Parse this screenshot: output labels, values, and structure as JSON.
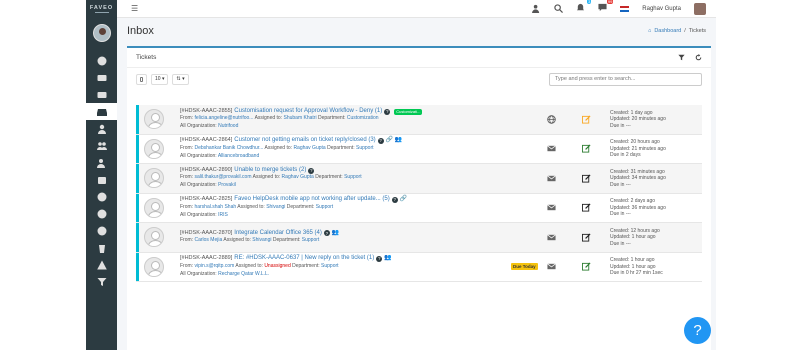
{
  "app": {
    "logo": "FAVEO"
  },
  "topbar": {
    "username": "Raghav Gupta",
    "notif_count": "3",
    "msg_count": "99"
  },
  "page": {
    "title": "Inbox",
    "breadcrumb_home": "Dashboard",
    "breadcrumb_current": "Tickets"
  },
  "card": {
    "title": "Tickets"
  },
  "controls": {
    "page_size": "10",
    "search_placeholder": "Type and press enter to search..."
  },
  "colors": {
    "sidebar": "#2c3b41",
    "accent": "#3c8dbc",
    "link": "#337ab7",
    "help": "#2196f3"
  },
  "tickets": [
    {
      "id": "[#HDSK-AAAC-2855]",
      "subject": "Customisation request for Approval Workflow - Deny (1)",
      "tag": "Customizati...",
      "from_label": "From:",
      "from": "felicia.angeline@nutrifoo...",
      "assigned_label": "Assigned to:",
      "assigned": "Shubam Khatri",
      "dept_label": "Department:",
      "dept": "Customization",
      "org_label": "All Organization:",
      "org": "Nutrifood",
      "created": "Created: 1 day ago",
      "updated": "Updated: 20 minutes ago",
      "due": "Due in ---",
      "stripe": "#00bcd4",
      "icon1": "globe",
      "icon2": "edit-yellow"
    },
    {
      "id": "[#HDSK-AAAC-2864]",
      "subject": "Customer not getting emails on ticket reply/closed (3)",
      "tag": "",
      "from_label": "From:",
      "from": "Debshankar Banik Chowdhur...",
      "assigned_label": "Assigned to:",
      "assigned": "Raghav Gupta",
      "dept_label": "Department:",
      "dept": "Support",
      "org_label": "All Organization:",
      "org": "Alliancebroadband",
      "created": "Created: 20 hours ago",
      "updated": "Updated: 21 minutes ago",
      "due": "Due in 2 days",
      "stripe": "#00bcd4",
      "icon1": "mail",
      "icon2": "edit-green"
    },
    {
      "id": "[#HDSK-AAAC-2890]",
      "subject": "Unable to merge tickets (2)",
      "tag": "",
      "from_label": "From:",
      "from": "salil.thakur@provakil.com",
      "assigned_label": "Assigned to:",
      "assigned": "Raghav Gupta",
      "dept_label": "Department:",
      "dept": "Support",
      "org_label": "All Organization:",
      "org": "Provakil",
      "created": "Created: 31 minutes ago",
      "updated": "Updated: 34 minutes ago",
      "due": "Due in ---",
      "stripe": "#00bcd4",
      "icon1": "mail",
      "icon2": "edit-dark"
    },
    {
      "id": "[#HDSK-AAAC-2825]",
      "subject": "Faveo HelpDesk mobile app not working after update... (5)",
      "tag": "",
      "from_label": "From:",
      "from": "harshal.shah Shah",
      "assigned_label": "Assigned to:",
      "assigned": "Shivangi",
      "dept_label": "Department:",
      "dept": "Support",
      "org_label": "All Organization:",
      "org": "IRIS",
      "created": "Created: 2 days ago",
      "updated": "Updated: 36 minutes ago",
      "due": "Due in ---",
      "stripe": "#00bcd4",
      "icon1": "mail",
      "icon2": "edit-dark"
    },
    {
      "id": "[#HDSK-AAAC-2870]",
      "subject": "Integrate Calendar Office 365 (4)",
      "tag": "",
      "from_label": "From:",
      "from": "Carlos Mejia",
      "assigned_label": "Assigned to:",
      "assigned": "Shivangi",
      "dept_label": "Department:",
      "dept": "Support",
      "org_label": "",
      "org": "",
      "created": "Created: 12 hours ago",
      "updated": "Updated: 1 hour ago",
      "due": "Due in ---",
      "stripe": "#00bcd4",
      "icon1": "mail",
      "icon2": "edit-dark"
    },
    {
      "id": "[#HDSK-AAAC-2889]",
      "subject": "RE: #HDSK-AAAC-0637 | New reply on the ticket (1)",
      "tag": "",
      "from_label": "From:",
      "from": "vipin.s@rqitp.com",
      "assigned_label": "Assigned to:",
      "assigned": "Unassigned",
      "dept_label": "Department:",
      "dept": "Support",
      "org_label": "All Organization:",
      "org": "Recharge Qatar W.L.L.",
      "created": "Created: 1 hour ago",
      "updated": "Updated: 1 hour ago",
      "due": "Due in 0 hr 27 min 1sec",
      "stripe": "#00bcd4",
      "icon1": "mail",
      "icon2": "edit-green",
      "due_badge": "Due Today"
    }
  ],
  "help": {
    "label": "?"
  }
}
